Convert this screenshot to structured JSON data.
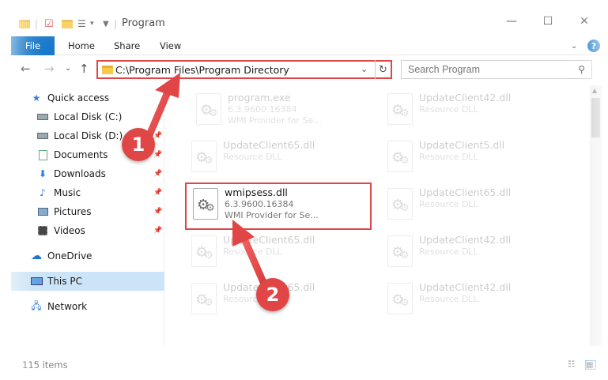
{
  "window": {
    "title": "Program",
    "minimize": "—",
    "maximize": "☐",
    "close": "✕"
  },
  "ribbon": {
    "tabs": [
      "File",
      "Home",
      "Share",
      "View"
    ],
    "help": "?"
  },
  "address": {
    "path": "C:\\Program Files\\Program Directory",
    "search_placeholder": "Search Program"
  },
  "sidebar": {
    "items": [
      {
        "label": "Quick access",
        "icon": "star-icon"
      },
      {
        "label": "Local Disk (C:)",
        "icon": "drive-icon"
      },
      {
        "label": "Local Disk (D:)",
        "icon": "drive-icon"
      },
      {
        "label": "Documents",
        "icon": "documents-icon"
      },
      {
        "label": "Downloads",
        "icon": "download-icon"
      },
      {
        "label": "Music",
        "icon": "music-icon"
      },
      {
        "label": "Pictures",
        "icon": "pictures-icon"
      },
      {
        "label": "Videos",
        "icon": "videos-icon"
      },
      {
        "label": "OneDrive",
        "icon": "cloud-icon"
      },
      {
        "label": "This PC",
        "icon": "computer-icon"
      },
      {
        "label": "Network",
        "icon": "network-icon"
      }
    ]
  },
  "files": [
    {
      "name": "program.exe",
      "line1": "6.3.9600.16384",
      "line2": "WMI Provider for Se..."
    },
    {
      "name": "UpdateClient42.dll",
      "line1": "Resource DLL",
      "line2": ""
    },
    {
      "name": "UpdateClient65.dll",
      "line1": "Resource DLL",
      "line2": ""
    },
    {
      "name": "UpdateClient5.dll",
      "line1": "Resource DLL",
      "line2": ""
    },
    {
      "name": "wmipsess.dll",
      "line1": "6.3.9600.16384",
      "line2": "WMI Provider for Se..."
    },
    {
      "name": "UpdateClient65.dll",
      "line1": "Resource DLL",
      "line2": ""
    },
    {
      "name": "UpdateClient65.dll",
      "line1": "Resource DLL",
      "line2": ""
    },
    {
      "name": "UpdateClient42.dll",
      "line1": "Resource DLL",
      "line2": ""
    },
    {
      "name": "UpdateClient65.dll",
      "line1": "Resource DLL",
      "line2": ""
    },
    {
      "name": "UpdateClient42.dll",
      "line1": "Resource DLL",
      "line2": ""
    }
  ],
  "status": {
    "count": "115 items"
  },
  "annotations": {
    "step1": "1",
    "step2": "2",
    "color": "#e04646"
  }
}
